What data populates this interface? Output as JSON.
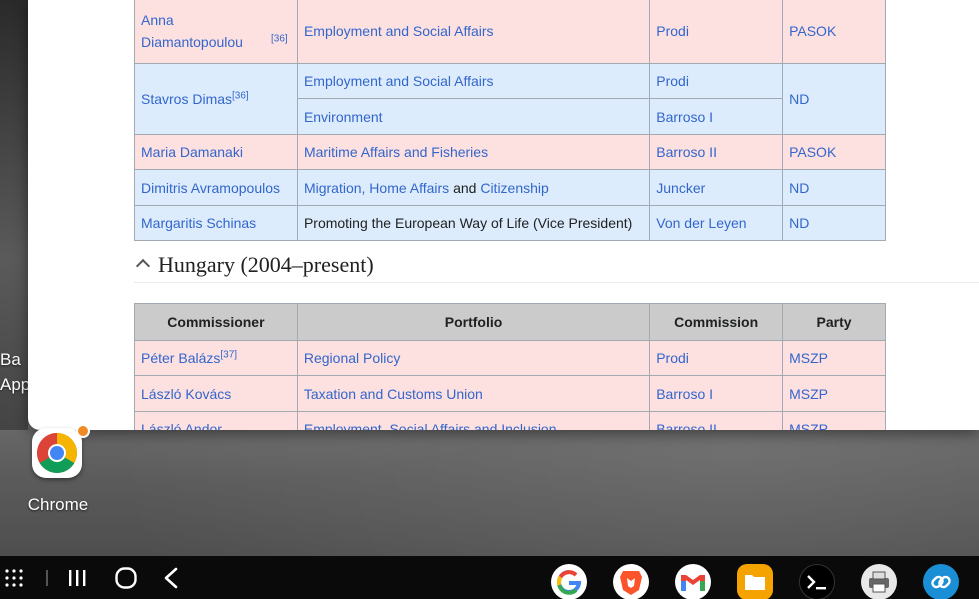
{
  "desktop": {
    "partial_labels": [
      "Ba",
      "App"
    ],
    "chrome_icon_label": "Chrome"
  },
  "greece_table": {
    "rows": [
      {
        "commissioner": "Anna Diamantopoulou",
        "ref": "[36]",
        "portfolio": "Employment and Social Affairs",
        "commission": "Prodi",
        "party": "PASOK",
        "color": "pink"
      },
      {
        "commissioner": "Stavros Dimas",
        "ref": "[36]",
        "portfolio": "Employment and Social Affairs",
        "commission": "Prodi",
        "party": "ND",
        "color": "blue"
      },
      {
        "portfolio": "Environment",
        "commission": "Barroso I"
      },
      {
        "commissioner": "Maria Damanaki",
        "portfolio": "Maritime Affairs and Fisheries",
        "commission": "Barroso II",
        "party": "PASOK",
        "color": "pink"
      },
      {
        "commissioner": "Dimitris Avramopoulos",
        "portfolio_a": "Migration, Home Affairs",
        "portfolio_and": "and",
        "portfolio_b": "Citizenship",
        "commission": "Juncker",
        "party": "ND",
        "color": "blue"
      },
      {
        "commissioner": "Margaritis Schinas",
        "portfolio": "Promoting the European Way of Life (Vice President)",
        "commission": "Von der Leyen",
        "party": "ND",
        "color": "blue"
      }
    ]
  },
  "hungary_section": {
    "heading": "Hungary (2004–present)",
    "headers": [
      "Commissioner",
      "Portfolio",
      "Commission",
      "Party"
    ],
    "rows": [
      {
        "commissioner": "Péter Balázs",
        "ref": "[37]",
        "portfolio": "Regional Policy",
        "commission": "Prodi",
        "party": "MSZP"
      },
      {
        "commissioner": "László Kovács",
        "portfolio": "Taxation and Customs Union",
        "commission": "Barroso I",
        "party": "MSZP"
      },
      {
        "commissioner": "László Andor",
        "portfolio": "Employment, Social Affairs and Inclusion",
        "commission": "Barroso II",
        "party": "MSZP"
      }
    ]
  },
  "taskbar": {
    "dock_apps": [
      "google-icon",
      "brave-icon",
      "gmail-icon",
      "files-icon",
      "terminal-icon",
      "printer-icon",
      "link-icon"
    ]
  },
  "colors": {
    "pink_row": "#fde0e0",
    "blue_row": "#dcecfc",
    "link": "#3366cc",
    "header": "#cbcbcb"
  }
}
